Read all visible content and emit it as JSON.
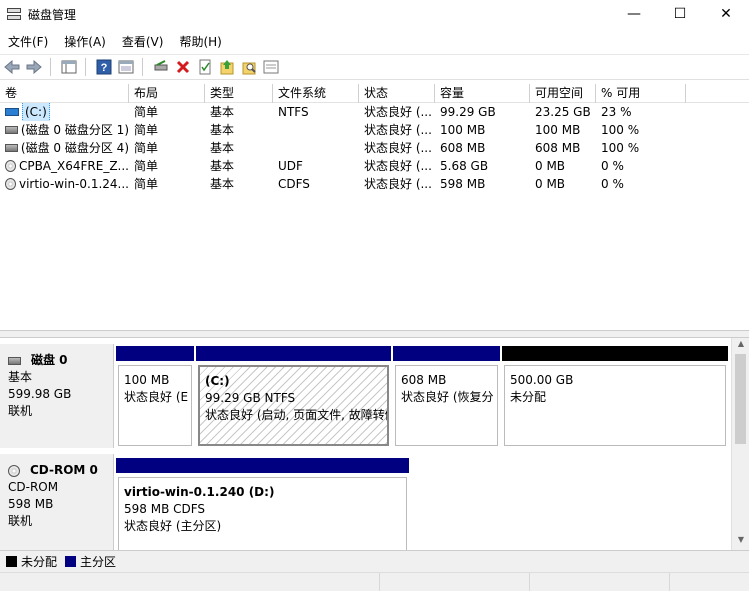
{
  "window": {
    "title": "磁盘管理",
    "minimize": "—",
    "maximize": "☐",
    "close": "✕"
  },
  "menu": [
    "文件(F)",
    "操作(A)",
    "查看(V)",
    "帮助(H)"
  ],
  "toolbar": {
    "buttons": [
      "back-arrow-icon",
      "forward-arrow-icon",
      "console-tree-icon",
      "help-icon",
      "show-pane-icon",
      "connect-icon",
      "delete-icon",
      "properties-icon",
      "up-arrow-icon",
      "search-icon",
      "wizard-icon"
    ]
  },
  "list": {
    "columns": [
      "卷",
      "布局",
      "类型",
      "文件系统",
      "状态",
      "容量",
      "可用空间",
      "% 可用"
    ],
    "rows": [
      {
        "icon": "drive-c-icon",
        "name": "(C:)",
        "layout": "简单",
        "type": "基本",
        "fs": "NTFS",
        "status": "状态良好 (...",
        "capacity": "99.29 GB",
        "free": "23.25 GB",
        "pct": "23 %"
      },
      {
        "icon": "disk-icon",
        "name": "(磁盘 0 磁盘分区 1)",
        "layout": "简单",
        "type": "基本",
        "fs": "",
        "status": "状态良好 (...",
        "capacity": "100 MB",
        "free": "100 MB",
        "pct": "100 %"
      },
      {
        "icon": "disk-icon",
        "name": "(磁盘 0 磁盘分区 4)",
        "layout": "简单",
        "type": "基本",
        "fs": "",
        "status": "状态良好 (...",
        "capacity": "608 MB",
        "free": "608 MB",
        "pct": "100 %"
      },
      {
        "icon": "cd-icon",
        "name": "CPBA_X64FRE_Z...",
        "layout": "简单",
        "type": "基本",
        "fs": "UDF",
        "status": "状态良好 (...",
        "capacity": "5.68 GB",
        "free": "0 MB",
        "pct": "0 %"
      },
      {
        "icon": "cd-icon",
        "name": "virtio-win-0.1.24...",
        "layout": "简单",
        "type": "基本",
        "fs": "CDFS",
        "status": "状态良好 (...",
        "capacity": "598 MB",
        "free": "0 MB",
        "pct": "0 %"
      }
    ]
  },
  "disks": [
    {
      "name": "磁盘 0",
      "type": "基本",
      "size": "599.98 GB",
      "state": "联机",
      "partitions": [
        {
          "line1": "",
          "line2": "100 MB",
          "line3": "状态良好 (E"
        },
        {
          "line1": "(C:)",
          "line2": "99.29 GB NTFS",
          "line3": "状态良好 (启动, 页面文件, 故障转储"
        },
        {
          "line1": "",
          "line2": "608 MB",
          "line3": "状态良好 (恢复分"
        },
        {
          "line1": "",
          "line2": "500.00 GB",
          "line3": "未分配"
        }
      ]
    },
    {
      "name": "CD-ROM 0",
      "type": "CD-ROM",
      "size": "598 MB",
      "state": "联机",
      "partitions": [
        {
          "line1": "virtio-win-0.1.240  (D:)",
          "line2": "598 MB CDFS",
          "line3": "状态良好 (主分区)"
        }
      ]
    }
  ],
  "legend": {
    "unallocated": "未分配",
    "primary": "主分区"
  },
  "colors": {
    "primary": "#000080",
    "unallocated": "#000000",
    "selection": "#cce8ff"
  }
}
